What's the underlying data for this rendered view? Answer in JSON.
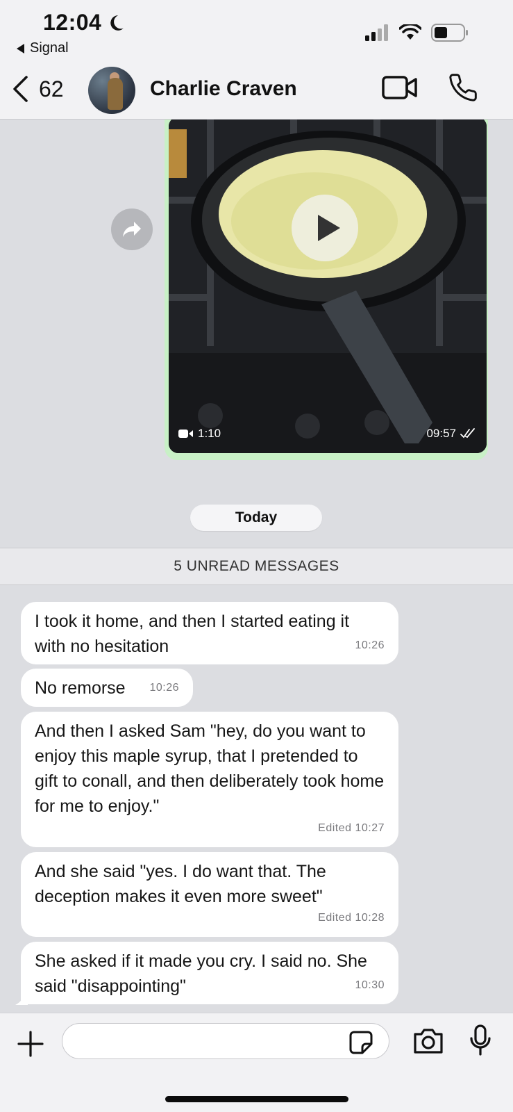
{
  "status_bar": {
    "time": "12:04",
    "back_app": "Signal"
  },
  "header": {
    "back_count": "62",
    "contact_name": "Charlie Craven"
  },
  "video_message": {
    "duration": "1:10",
    "time": "09:57"
  },
  "date_divider": "Today",
  "unread_banner": "5 UNREAD MESSAGES",
  "messages": [
    {
      "text": "I took it home, and then I started eating it with no hesitation",
      "meta": "10:26"
    },
    {
      "text": "No remorse",
      "meta": "10:26"
    },
    {
      "text": "And then I asked Sam \"hey, do you want to enjoy this maple syrup, that I pretended to gift to conall, and then deliberately took home for me to enjoy.\"",
      "meta": "Edited 10:27"
    },
    {
      "text": "And she said \"yes. I do want that. The deception makes it even more sweet\"",
      "meta": "Edited 10:28"
    },
    {
      "text": "She asked if it made you cry. I said no. She said \"disappointing\"",
      "meta": "10:30"
    }
  ],
  "composer": {
    "input_value": "",
    "placeholder": ""
  },
  "colors": {
    "outgoing_border": "#c8f0c6",
    "background": "#dcdde1",
    "bubble": "#ffffff"
  }
}
